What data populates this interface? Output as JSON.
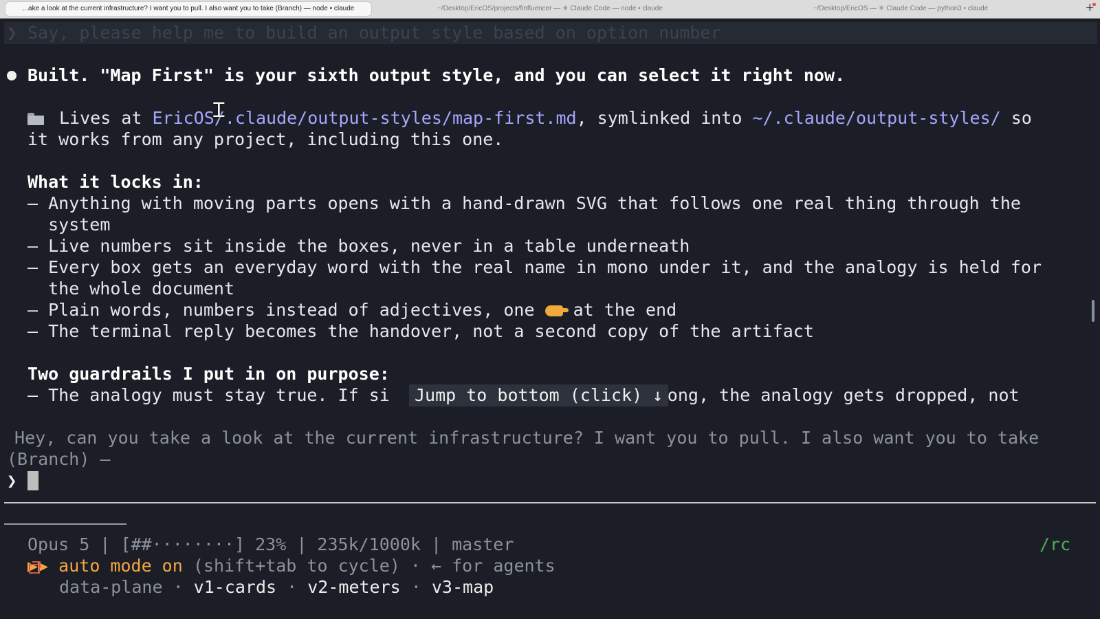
{
  "tabs": [
    {
      "title": "...ake a look at the current infrastructure? I want you to pull. I also want you to take (Branch) — node • claude",
      "active": true
    },
    {
      "title": "~/Desktop/EricOS/projects/finfluencer — ✳ Claude Code — node • claude",
      "active": false
    },
    {
      "title": "~/Desktop/EricOS — ✳ Claude Code — python3 • claude",
      "active": false
    }
  ],
  "new_tab_label": "+",
  "terminal": {
    "previous_prompt": "❯ Say, please help me to build an output style based on option number",
    "headline": "Built. \"Map First\" is your sixth output style, and you can select it right now.",
    "lives": {
      "icon": "folder-icon",
      "prefix": "Lives at ",
      "path": "EricOS/.claude/output-styles/map-first.md",
      "middle": ", symlinked into ",
      "link_dir": "~/.claude/output-styles/",
      "suffix": " so",
      "line2": "it works from any project, including this one."
    },
    "section1": {
      "heading": "What it locks in:",
      "lines": [
        "– Anything with moving parts opens with a hand-drawn SVG that follows one real thing through the",
        "  system",
        "– Live numbers sit inside the boxes, never in a table underneath",
        "– Every box gets an everyday word with the real name in mono under it, and the analogy is held for",
        "  the whole document"
      ],
      "plain_words_before": "– Plain words, numbers instead of adjectives, one ",
      "plain_words_icon": "pointing-hand-icon",
      "plain_words_after": " at the end",
      "last_line": "– The terminal reply becomes the handover, not a second copy of the artifact"
    },
    "section2": {
      "heading": "Two guardrails I put in on purpose:",
      "line_before": "– The analogy must stay true. If si",
      "line_after": "ong, the analogy gets dropped, not"
    },
    "jump_button": "Jump to bottom (click) ↓",
    "queued_message_line1": " Hey, can you take a look at the current infrastructure? I want you to pull. I also want you to take",
    "queued_message_line2": "(Branch) —",
    "prompt_symbol": "❯"
  },
  "status": {
    "model_line": "Opus 5 | [##········] 23% | 235k/1000k | master",
    "context_percent": 23,
    "rc": "/rc",
    "mode_arrows": "▶▶",
    "mode_label": "auto mode on",
    "mode_hint": " (shift+tab to cycle) · ← for agents",
    "branch_icon": "branch-icon",
    "worktrees_first": "data-plane",
    "worktrees_sep": " · ",
    "worktrees": [
      "v1-cards",
      "v2-meters",
      "v3-map"
    ]
  },
  "colors": {
    "background": "#1b1e26",
    "link": "#a6a6ff",
    "accent_orange": "#f3a641",
    "rc_green": "#4caf50"
  }
}
